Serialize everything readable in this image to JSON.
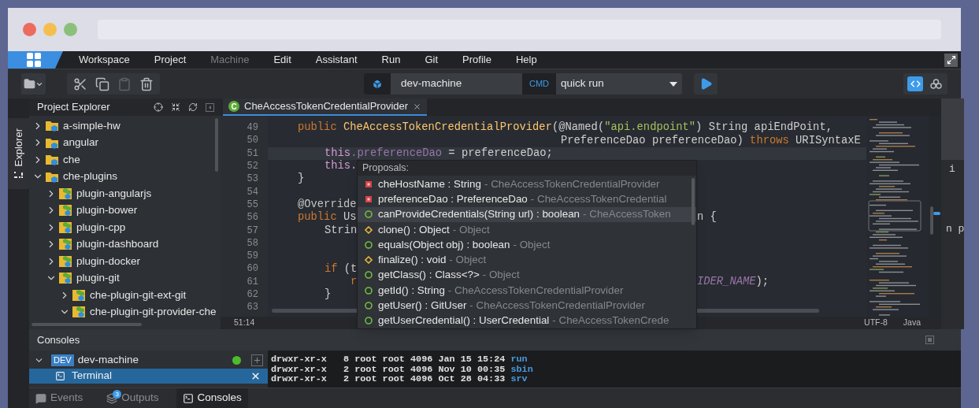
{
  "browser": {
    "traffic_lights": [
      {
        "color": "#ee6a5f"
      },
      {
        "color": "#f5bf4f"
      },
      {
        "color": "#8cc07a"
      }
    ]
  },
  "menu": {
    "items": [
      {
        "label": "Workspace",
        "disabled": false
      },
      {
        "label": "Project",
        "disabled": false
      },
      {
        "label": "Machine",
        "disabled": true
      },
      {
        "label": "Edit",
        "disabled": false
      },
      {
        "label": "Assistant",
        "disabled": false
      },
      {
        "label": "Run",
        "disabled": false
      },
      {
        "label": "Git",
        "disabled": false
      },
      {
        "label": "Profile",
        "disabled": false
      },
      {
        "label": "Help",
        "disabled": false
      }
    ]
  },
  "toolbar": {
    "edit_buttons": [
      {
        "kind": "cut",
        "disabled": false
      },
      {
        "kind": "copy",
        "disabled": false
      },
      {
        "kind": "paste",
        "disabled": true
      },
      {
        "kind": "delete",
        "disabled": false
      }
    ],
    "machine": {
      "value": "dev-machine"
    },
    "command_label": "CMD",
    "command": {
      "value": "quick run"
    },
    "view_toggles": [
      {
        "kind": "code",
        "selected": true
      },
      {
        "kind": "cluster",
        "selected": false
      }
    ]
  },
  "explorer": {
    "side_tab": {
      "label": "Explorer",
      "selected": true
    },
    "title": "Project Explorer",
    "tree": [
      {
        "label": "a-simple-hw",
        "kind": "project",
        "expanded": false
      },
      {
        "label": "angular",
        "kind": "project",
        "expanded": false
      },
      {
        "label": "che",
        "kind": "project",
        "expanded": false
      },
      {
        "label": "che-plugins",
        "kind": "project",
        "expanded": true,
        "children": [
          {
            "label": "plugin-angularjs",
            "kind": "module",
            "expanded": false
          },
          {
            "label": "plugin-bower",
            "kind": "module",
            "expanded": false
          },
          {
            "label": "plugin-cpp",
            "kind": "module",
            "expanded": false
          },
          {
            "label": "plugin-dashboard",
            "kind": "module",
            "expanded": false
          },
          {
            "label": "plugin-docker",
            "kind": "module",
            "expanded": false
          },
          {
            "label": "plugin-git",
            "kind": "module",
            "expanded": true,
            "children": [
              {
                "label": "che-plugin-git-ext-git",
                "kind": "module",
                "expanded": false
              },
              {
                "label": "che-plugin-git-provider-che",
                "kind": "module",
                "expanded": true
              }
            ]
          }
        ]
      }
    ]
  },
  "editor": {
    "tabs": [
      {
        "label": "CheAccessTokenCredentialProvider",
        "icon_letter": "C",
        "selected": true
      }
    ],
    "lines": [
      {
        "number": "49",
        "current": false,
        "kind": "member",
        "code": [
          {
            "kind": "keyword",
            "text": "public "
          },
          {
            "kind": "class",
            "text": "CheAccessTokenCredentialProvider"
          },
          {
            "kind": "plain",
            "text": "(@Named("
          },
          {
            "kind": "string",
            "text": "\"api.endpoint\""
          },
          {
            "kind": "plain",
            "text": ") String apiEndPoint,"
          }
        ]
      },
      {
        "number": "50",
        "current": false,
        "kind": "continuation",
        "code": [
          {
            "kind": "plain",
            "text": "PreferenceDao preferenceDao) "
          },
          {
            "kind": "keyword",
            "text": "throws"
          },
          {
            "kind": "plain",
            "text": " URISyntaxE"
          }
        ]
      },
      {
        "number": "51",
        "current": true,
        "kind": "body",
        "code": [
          {
            "kind": "this",
            "text": "this"
          },
          {
            "kind": "field",
            "text": ".preferenceDao"
          },
          {
            "kind": "plain",
            "text": " = preferenceDao;"
          }
        ]
      },
      {
        "number": "52",
        "current": false,
        "kind": "body",
        "code": [
          {
            "kind": "this",
            "text": "this."
          }
        ]
      },
      {
        "number": "53",
        "current": false,
        "kind": "member",
        "code": [
          {
            "kind": "plain",
            "text": "}"
          }
        ]
      },
      {
        "number": "54",
        "current": false
      },
      {
        "number": "55",
        "current": false,
        "kind": "member",
        "code": [
          {
            "kind": "annotation",
            "text": "@Override"
          }
        ]
      },
      {
        "number": "56",
        "current": false,
        "kind": "member",
        "code": [
          {
            "kind": "keyword",
            "text": "public "
          },
          {
            "kind": "plain",
            "text": "Us"
          }
        ],
        "tail": [
          {
            "kind": "plain",
            "text": "n {"
          }
        ]
      },
      {
        "number": "57",
        "current": false,
        "kind": "body",
        "code": [
          {
            "kind": "plain",
            "text": "Strin"
          }
        ]
      },
      {
        "number": "58",
        "current": false
      },
      {
        "number": "59",
        "current": false
      },
      {
        "number": "60",
        "current": false,
        "kind": "body",
        "code": [
          {
            "kind": "keyword",
            "text": "if "
          },
          {
            "kind": "plain",
            "text": "(t"
          }
        ]
      },
      {
        "number": "61",
        "current": false,
        "kind": "nested",
        "code": [
          {
            "kind": "keyword",
            "text": "r"
          }
        ],
        "tail": [
          {
            "kind": "constant",
            "text": "IDER_NAME"
          },
          {
            "kind": "plain",
            "text": ");"
          }
        ]
      },
      {
        "number": "62",
        "current": false,
        "kind": "body",
        "code": [
          {
            "kind": "plain",
            "text": "}"
          }
        ]
      },
      {
        "number": "63",
        "current": false
      }
    ],
    "proposals": {
      "title": "Proposals:",
      "items": [
        {
          "kind": "field",
          "name": "cheHostName : String",
          "owner": "- CheAccessTokenCredentialProvider",
          "selected": false
        },
        {
          "kind": "field",
          "name": "preferenceDao : PreferenceDao",
          "owner": "- CheAccessTokenCredential",
          "selected": false
        },
        {
          "kind": "method",
          "name": "canProvideCredentials(String url) : boolean",
          "owner": "- CheAccessToken",
          "selected": true
        },
        {
          "kind": "protected-method",
          "name": "clone() : Object",
          "owner": "- Object",
          "selected": false
        },
        {
          "kind": "method",
          "name": "equals(Object obj) : boolean",
          "owner": "- Object",
          "selected": false
        },
        {
          "kind": "protected-method",
          "name": "finalize() : void",
          "owner": "- Object",
          "selected": false
        },
        {
          "kind": "method",
          "name": "getClass() : Class<?>",
          "owner": "- Object",
          "selected": false
        },
        {
          "kind": "method",
          "name": "getId() : String",
          "owner": "- CheAccessTokenCredentialProvider",
          "selected": false
        },
        {
          "kind": "method",
          "name": "getUser() : GitUser",
          "owner": "- CheAccessTokenCredentialProvider",
          "selected": false
        },
        {
          "kind": "method",
          "name": "getUserCredential() : UserCredential",
          "owner": "- CheAccessTokenCrede",
          "selected": false
        }
      ]
    },
    "status": {
      "position": "51:14",
      "encoding": "UTF-8",
      "language": "Java"
    }
  },
  "behind_window": {
    "texts": [
      "i",
      "n p"
    ]
  },
  "consoles": {
    "title": "Consoles",
    "machines": [
      {
        "label": "dev-machine",
        "badge": "DEV",
        "running": true,
        "expanded": true,
        "terminals": [
          {
            "label": "Terminal",
            "selected": true
          }
        ]
      }
    ],
    "output": [
      {
        "text": "drwxr-xr-x   8 root root 4096 Jan 15 15:24",
        "name": "run"
      },
      {
        "text": "drwxr-xr-x   2 root root 4096 Nov 10 00:35",
        "name": "sbin"
      },
      {
        "text": "drwxr-xr-x   2 root root 4096 Oct 28 04:33",
        "name": "srv"
      }
    ]
  },
  "bottom_tabs": [
    {
      "kind": "events",
      "label": "Events",
      "selected": false
    },
    {
      "kind": "outputs",
      "label": "Outputs",
      "badge": "3",
      "selected": false
    },
    {
      "kind": "consoles",
      "label": "Consoles",
      "selected": true
    }
  ]
}
